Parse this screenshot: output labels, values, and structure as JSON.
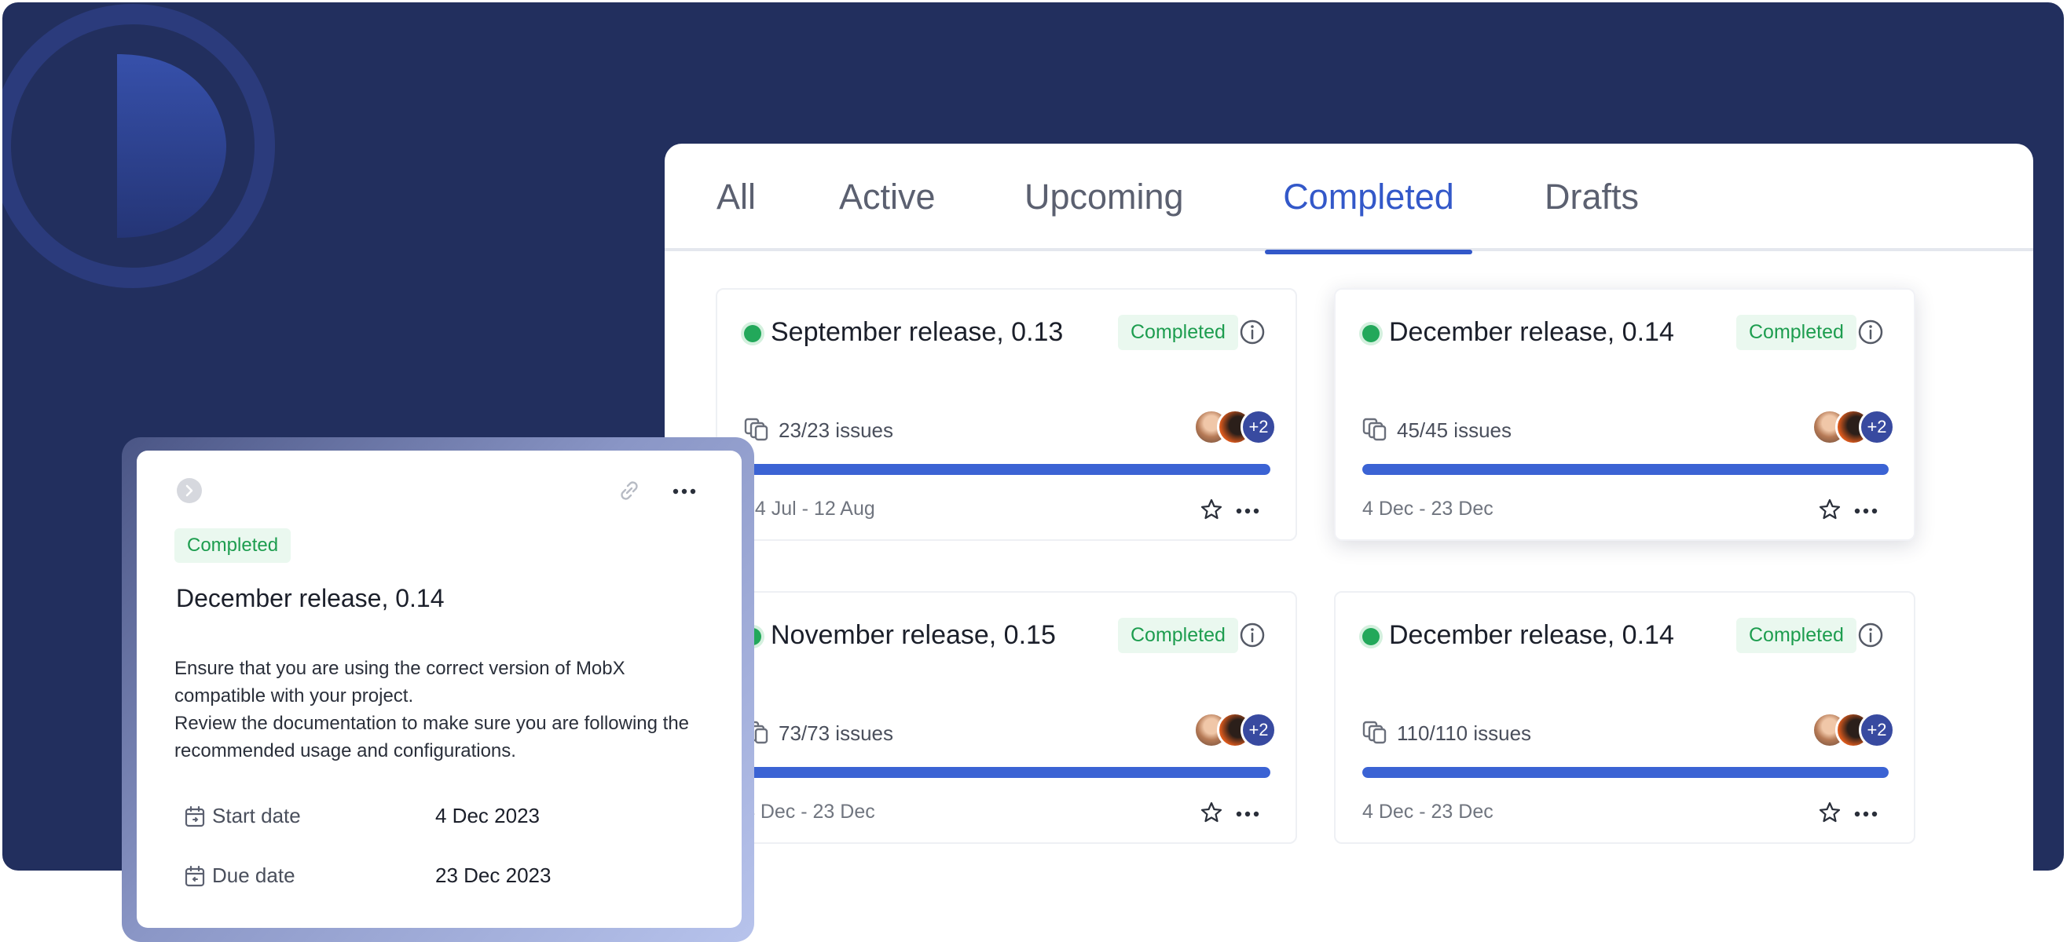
{
  "tabs": [
    {
      "label": "All",
      "active": false
    },
    {
      "label": "Active",
      "active": false
    },
    {
      "label": "Upcoming",
      "active": false
    },
    {
      "label": "Completed",
      "active": true
    },
    {
      "label": "Drafts",
      "active": false
    }
  ],
  "cards": [
    {
      "title": "September release, 0.13",
      "status": "Completed",
      "issues": "23/23 issues",
      "dates": "24 Jul - 12 Aug",
      "progress": 1.0,
      "extra_members": "+2"
    },
    {
      "title": "December release, 0.14",
      "status": "Completed",
      "issues": "45/45 issues",
      "dates": "4 Dec - 23 Dec",
      "progress": 1.0,
      "extra_members": "+2"
    },
    {
      "title": "November release, 0.15",
      "status": "Completed",
      "issues": "73/73 issues",
      "dates": "4 Dec - 23 Dec",
      "progress": 1.0,
      "extra_members": "+2"
    },
    {
      "title": "December release, 0.14",
      "status": "Completed",
      "issues": "110/110 issues",
      "dates": "4 Dec - 23 Dec",
      "progress": 1.0,
      "extra_members": "+2"
    }
  ],
  "detail": {
    "status": "Completed",
    "title": "December release, 0.14",
    "description_line1": "Ensure that you are using the correct version of MobX compatible with your project.",
    "description_line2": "Review the documentation to make sure you are following the recommended usage and configurations.",
    "start_label": "Start date",
    "start_value": "4 Dec 2023",
    "due_label": "Due date",
    "due_value": "23 Dec 2023"
  },
  "colors": {
    "background": "#222f5e",
    "accent": "#3358c9",
    "progress": "#3b63d4",
    "status_green": "#22a85a"
  },
  "icons": [
    "logo-icon",
    "info-icon",
    "issues-icon",
    "star-icon",
    "more-icon",
    "chevron-right-icon",
    "link-icon",
    "calendar-icon"
  ]
}
